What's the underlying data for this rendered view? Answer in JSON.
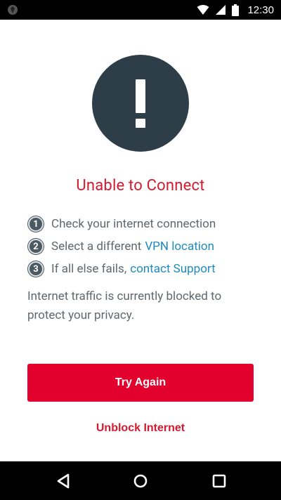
{
  "status_bar": {
    "time": "12:30",
    "icons": [
      "app-notification-icon",
      "wifi-icon",
      "cell-signal-icon",
      "battery-icon"
    ]
  },
  "alert": {
    "icon": "exclamation-icon",
    "circle_color": "#2d3e48"
  },
  "title": "Unable to Connect",
  "steps": [
    {
      "number": "1",
      "text": "Check your internet connection",
      "link": ""
    },
    {
      "number": "2",
      "text": "Select a different",
      "link": "VPN location"
    },
    {
      "number": "3",
      "text": "If all else fails,",
      "link": "contact Support"
    }
  ],
  "info_text": "Internet traffic is currently blocked to protect your privacy.",
  "buttons": {
    "try_again": "Try Again",
    "unblock": "Unblock Internet"
  },
  "colors": {
    "accent_red": "#e2012d",
    "title_red": "#d5192f",
    "link_blue": "#1e8bc3",
    "text_gray": "#60686d"
  },
  "nav_bar": {
    "icons": [
      "back-icon",
      "home-icon",
      "recents-icon"
    ]
  }
}
